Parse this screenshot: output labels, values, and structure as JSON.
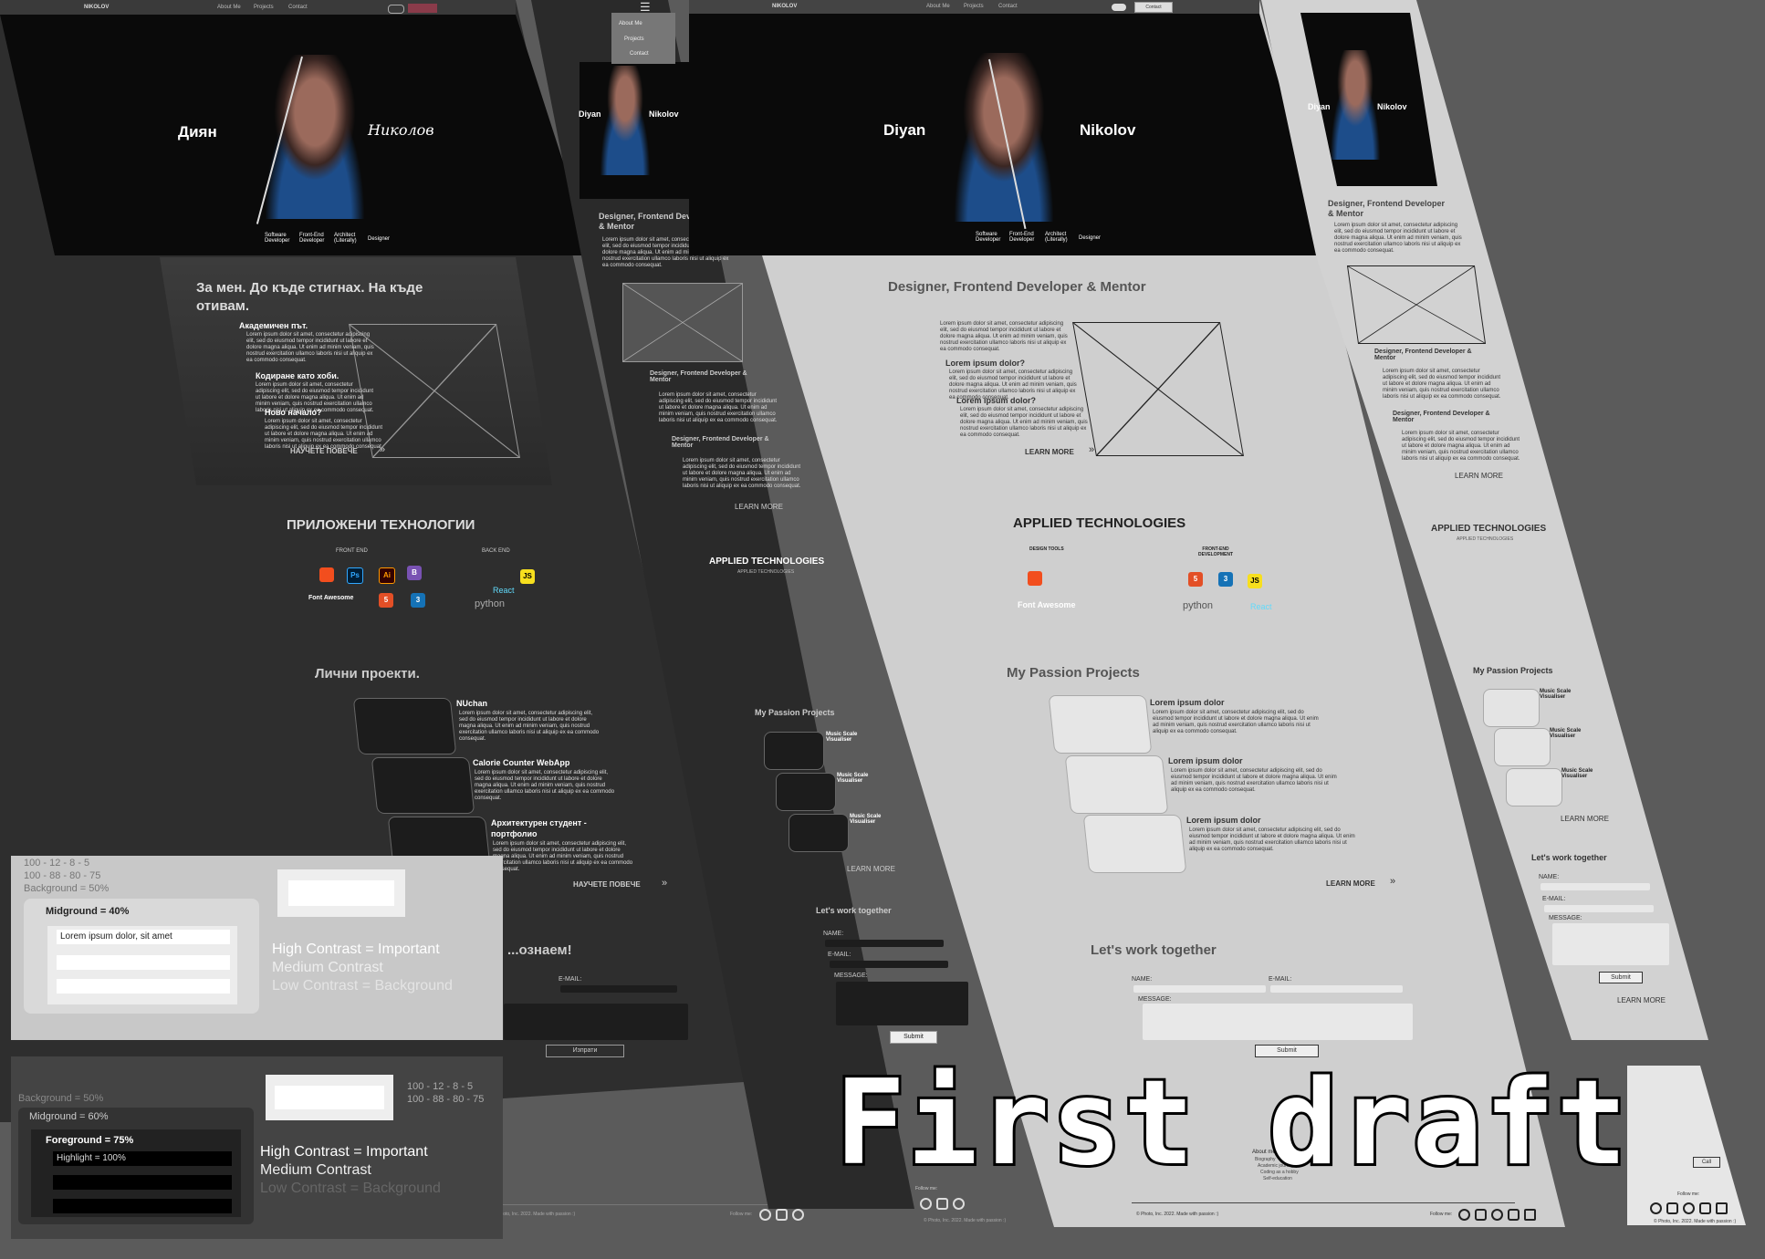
{
  "caption": "First draft",
  "nav": {
    "logo": "NIKOLOV",
    "items": [
      "About Me",
      "Projects",
      "Contact"
    ],
    "cta": "Contact"
  },
  "mobile_menu": [
    "About Me",
    "Projects",
    "Contact"
  ],
  "hero": {
    "bg_first": "Диян",
    "bg_last": "Николов",
    "en_first": "Diyan",
    "en_last": "Nikolov",
    "roles": [
      "Software Developer",
      "Front-End Developer",
      "Architect (Literally)",
      "Designer"
    ]
  },
  "about_bg": {
    "title": "За мен. До къде стигнах. На къде отивам.",
    "sections": [
      "Академичен път.",
      "Кодиране като хоби.",
      "Ново начало?"
    ],
    "learn_more": "НАУЧЕТЕ ПОВЕЧЕ"
  },
  "about_en": {
    "title": "Designer, Frontend Developer & Mentor",
    "sections": [
      "Lorem ipsum dolor?",
      "Lorem ipsum dolor?"
    ],
    "sub_title": "Designer, Frontend Developer & Mentor",
    "learn_more": "LEARN MORE"
  },
  "lorem": "Lorem ipsum dolor sit amet, consectetur adipiscing elit, sed do eiusmod tempor incididunt ut labore et dolore magna aliqua. Ut enim ad minim veniam, quis nostrud exercitation ullamco laboris nisi ut aliquip ex ea commodo consequat.",
  "tech_bg": {
    "title": "ПРИЛОЖЕНИ ТЕХНОЛОГИИ",
    "front": "FRONT END",
    "back": "BACK END"
  },
  "tech_en": {
    "title": "APPLIED TECHNOLOGIES",
    "subtitle": "APPLIED TECHNOLOGIES",
    "design": "DESIGN TOOLS",
    "frontend": "FRONT-END DEVELOPMENT"
  },
  "tech_logos": {
    "font_awesome": "Font Awesome",
    "react": "React",
    "python": "python",
    "js": "JS",
    "ps": "Ps",
    "ai": "Ai",
    "b": "B"
  },
  "projects_bg": {
    "title": "Лични проекти.",
    "items": [
      "NUchan",
      "Calorie Counter WebApp",
      "Архитектурен студент - портфолио"
    ],
    "learn_more": "НАУЧЕТЕ ПОВЕЧЕ"
  },
  "projects_en": {
    "title": "My Passion Projects",
    "items": [
      "Lorem ipsum dolor",
      "Lorem ipsum dolor",
      "Lorem ipsum dolor"
    ],
    "mobile_items": [
      "Music Scale Visualiser",
      "Music Scale Visualiser",
      "Music Scale Visualiser"
    ],
    "learn_more": "LEARN MORE"
  },
  "contact_bg": {
    "title": "...ознаем!",
    "email": "E-MAIL:",
    "submit": "Изпрати"
  },
  "contact_en": {
    "title": "Let's work together",
    "name": "NAME:",
    "email": "E-MAIL:",
    "message": "MESSAGE:",
    "submit": "Submit"
  },
  "footer": {
    "follow": "Follow me:",
    "copyright": "© Photo, Inc. 2022. Made with passion :)",
    "about_col": "About me",
    "about_links": [
      "Biography",
      "Academic journey",
      "Coding as a hobby",
      "Self-education"
    ],
    "call": "Call"
  },
  "legend_light": {
    "scale1": "100 - 12 - 8 - 5",
    "scale2": "100 - 88 - 80 - 75",
    "background": "Background = 50%",
    "midground": "Midground = 40%",
    "sample": "Lorem ipsum dolor, sit amet",
    "high": "High Contrast = Important",
    "medium": "Medium Contrast",
    "low": "Low Contrast = Background"
  },
  "legend_dark": {
    "background": "Background = 50%",
    "midground": "Midground = 60%",
    "foreground": "Foreground = 75%",
    "highlight": "Highlight = 100%",
    "scale1": "100 - 12 - 8 - 5",
    "scale2": "100 - 88 - 80 - 75",
    "high": "High Contrast = Important",
    "medium": "Medium Contrast",
    "low": "Low Contrast = Background"
  },
  "colors": {
    "dark_page": "#2e2e2e",
    "light_page": "#cfcfcf",
    "hero": "#0a0a0a",
    "canvas": "#5b5b5b"
  }
}
